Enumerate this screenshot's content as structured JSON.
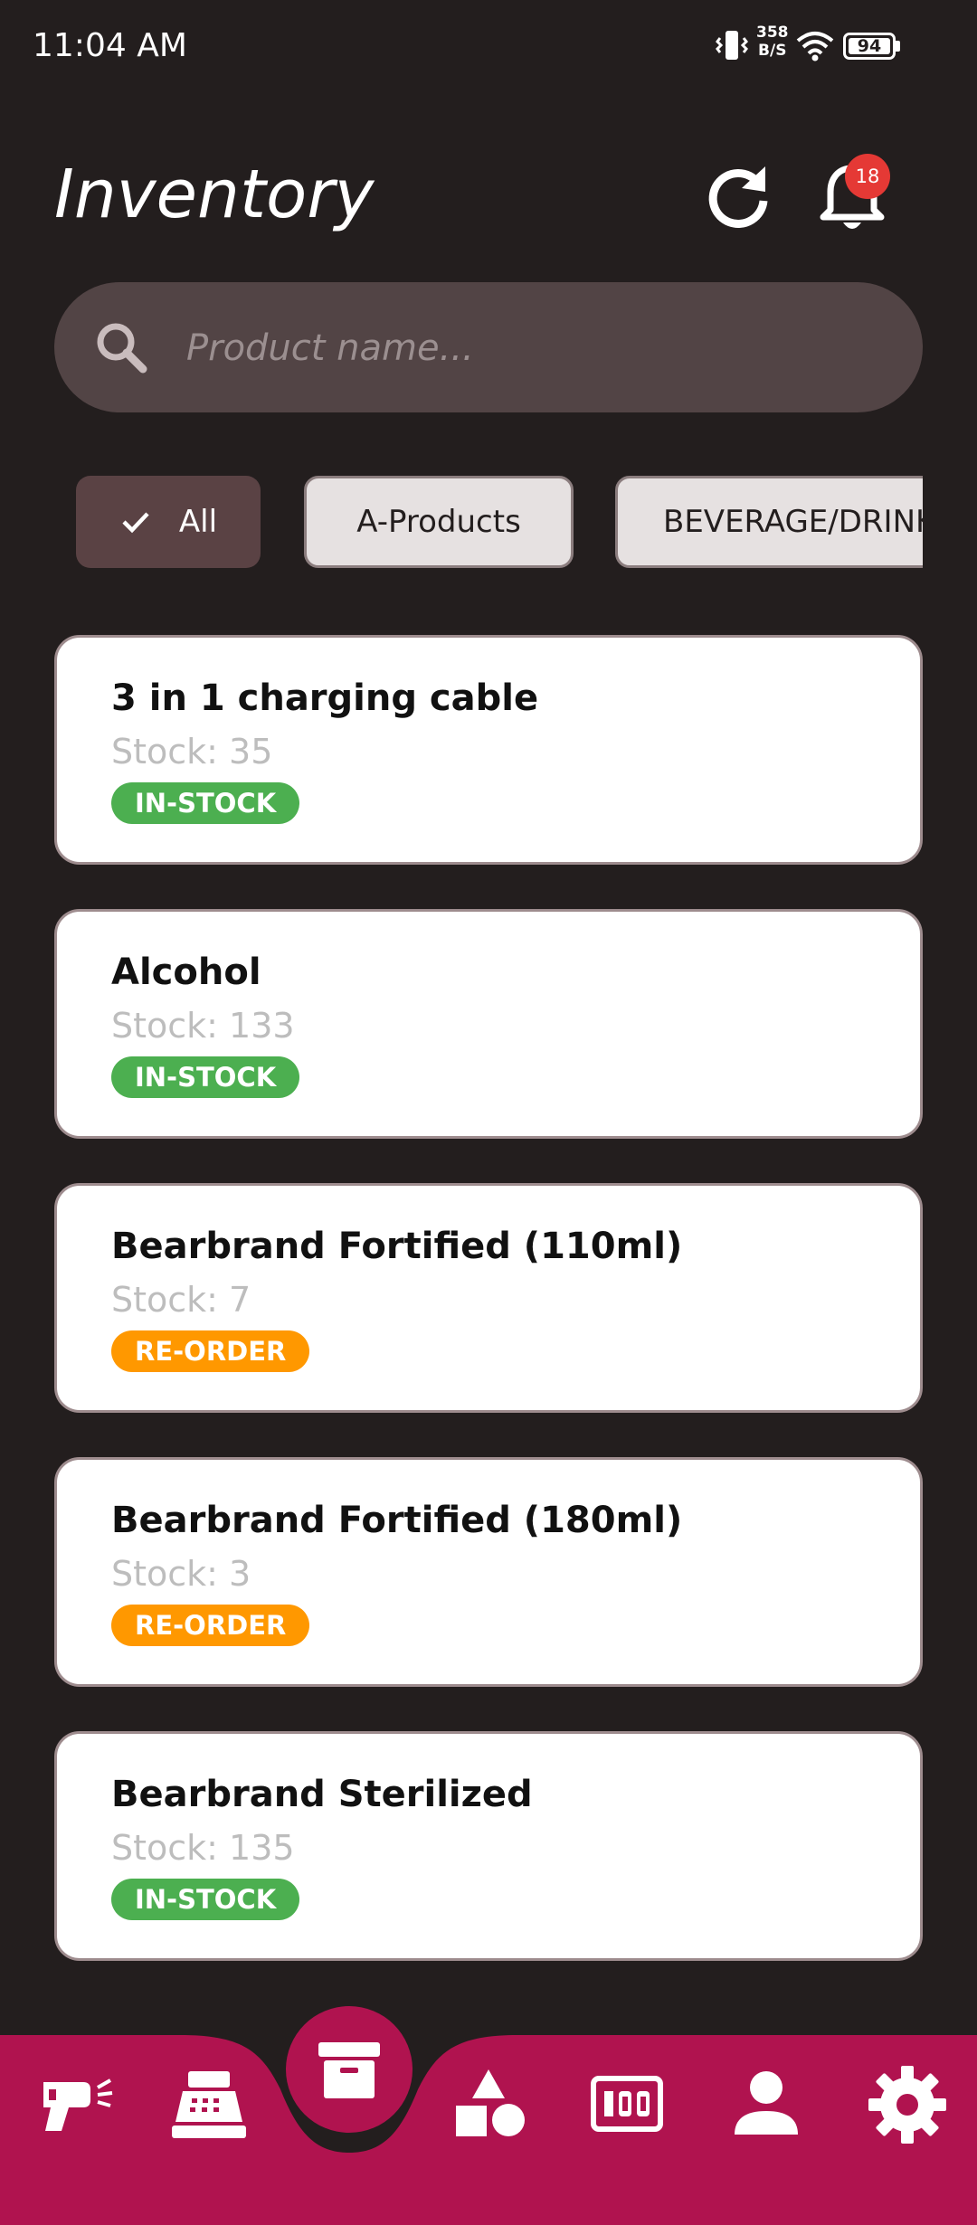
{
  "status_bar": {
    "time": "11:04 AM",
    "net_speed_value": "358",
    "net_speed_unit": "B/S",
    "battery": "94"
  },
  "header": {
    "title": "Inventory",
    "notification_count": "18"
  },
  "search": {
    "placeholder": "Product name..."
  },
  "filters": [
    {
      "label": "All",
      "selected": true
    },
    {
      "label": "A-Products",
      "selected": false
    },
    {
      "label": "BEVERAGE/DRINKS",
      "selected": false
    }
  ],
  "products": [
    {
      "name": "3 in 1 charging cable",
      "stock": "Stock: 35",
      "status": "IN-STOCK",
      "status_color": "#4caf50"
    },
    {
      "name": "Alcohol",
      "stock": "Stock: 133",
      "status": "IN-STOCK",
      "status_color": "#4caf50"
    },
    {
      "name": "Bearbrand Fortified (110ml)",
      "stock": "Stock: 7",
      "status": "RE-ORDER",
      "status_color": "#ff9800"
    },
    {
      "name": "Bearbrand Fortified (180ml)",
      "stock": "Stock: 3",
      "status": "RE-ORDER",
      "status_color": "#ff9800"
    },
    {
      "name": "Bearbrand Sterilized",
      "stock": "Stock: 135",
      "status": "IN-STOCK",
      "status_color": "#4caf50"
    }
  ],
  "bottom_nav": {
    "items": [
      "barcode-scanner-icon",
      "cash-register-icon",
      "inventory-box-icon",
      "shapes-icon",
      "counter-icon",
      "person-icon",
      "gear-icon"
    ],
    "active": "inventory-box-icon",
    "color": "#b0134f"
  },
  "colors": {
    "background": "#231e1e",
    "search": "#524445",
    "accent": "#b0134f",
    "badge": "#e53935"
  }
}
